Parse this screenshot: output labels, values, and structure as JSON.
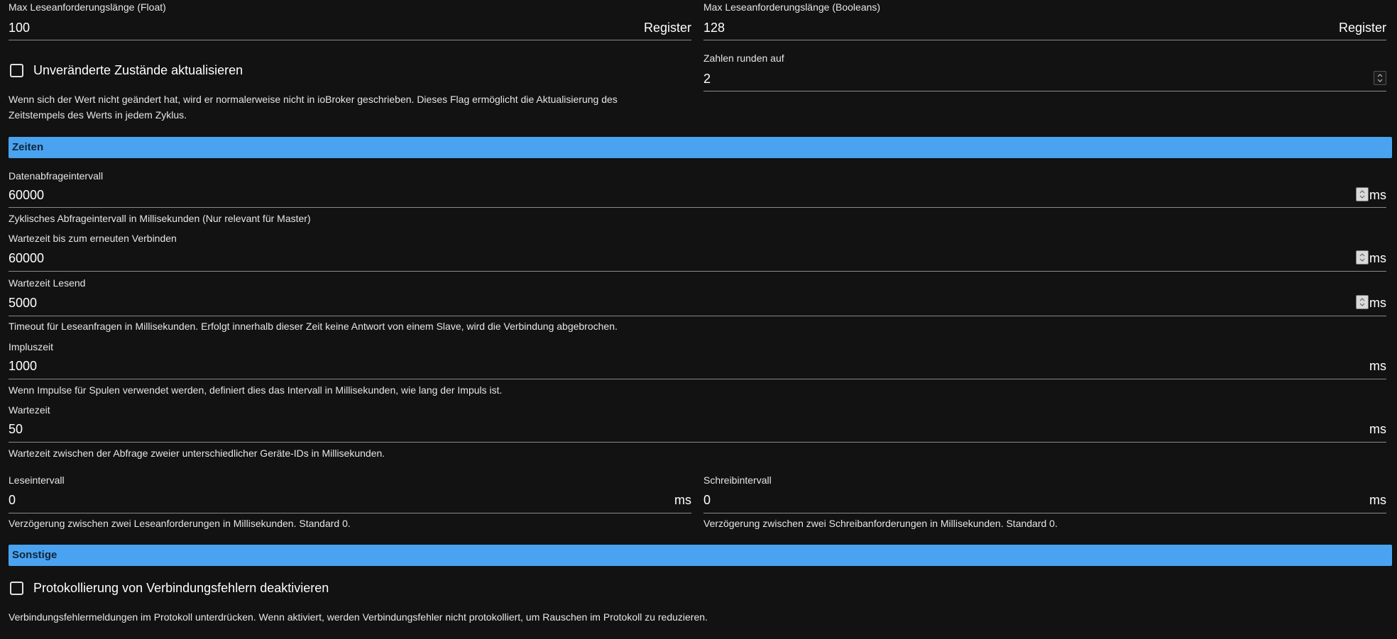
{
  "general": {
    "float_len": {
      "label": "Max Leseanforderungslänge (Float)",
      "value": "100",
      "unit": "Register"
    },
    "bool_len": {
      "label": "Max Leseanforderungslänge (Booleans)",
      "value": "128",
      "unit": "Register"
    },
    "update_unchanged": {
      "label": "Unveränderte Zustände aktualisieren",
      "checked": false,
      "help_line1": "Wenn sich der Wert nicht geändert hat, wird er normalerweise nicht in ioBroker geschrieben. Dieses Flag ermöglicht die Aktualisierung des",
      "help_line2": "Zeitstempels des Werts in jedem Zyklus."
    },
    "round": {
      "label": "Zahlen runden auf",
      "value": "2"
    }
  },
  "timing": {
    "header": "Zeiten",
    "poll": {
      "label": "Datenabfrageintervall",
      "value": "60000",
      "unit": "ms",
      "help": "Zyklisches Abfrageintervall in Millisekunden (Nur relevant für Master)"
    },
    "reconnect": {
      "label": "Wartezeit bis zum erneuten Verbinden",
      "value": "60000",
      "unit": "ms"
    },
    "read_timeout": {
      "label": "Wartezeit Lesend",
      "value": "5000",
      "unit": "ms",
      "help": "Timeout für Leseanfragen in Millisekunden. Erfolgt innerhalb dieser Zeit keine Antwort von einem Slave, wird die Verbindung abgebrochen."
    },
    "pulse": {
      "label": "Impluszeit",
      "value": "1000",
      "unit": "ms",
      "help": "Wenn Impulse für Spulen verwendet werden, definiert dies das Intervall in Millisekunden, wie lang der Impuls ist."
    },
    "wait": {
      "label": "Wartezeit",
      "value": "50",
      "unit": "ms",
      "help": "Wartezeit zwischen der Abfrage zweier unterschiedlicher Geräte-IDs in Millisekunden."
    },
    "read_interval": {
      "label": "Leseintervall",
      "value": "0",
      "unit": "ms",
      "help": "Verzögerung zwischen zwei Leseanforderungen in Millisekunden. Standard 0."
    },
    "write_interval": {
      "label": "Schreibintervall",
      "value": "0",
      "unit": "ms",
      "help": "Verzögerung zwischen zwei Schreibanforderungen in Millisekunden. Standard 0."
    }
  },
  "misc": {
    "header": "Sonstige",
    "disable_conn_errors": {
      "label": "Protokollierung von Verbindungsfehlern deaktivieren",
      "checked": false,
      "help": "Verbindungsfehlermeldungen im Protokoll unterdrücken. Wenn aktiviert, werden Verbindungsfehler nicht protokolliert, um Rauschen im Protokoll zu reduzieren."
    }
  },
  "colors": {
    "background": "#121212",
    "section_band": "#4aa3f0",
    "underline": "#8a8a8a"
  }
}
